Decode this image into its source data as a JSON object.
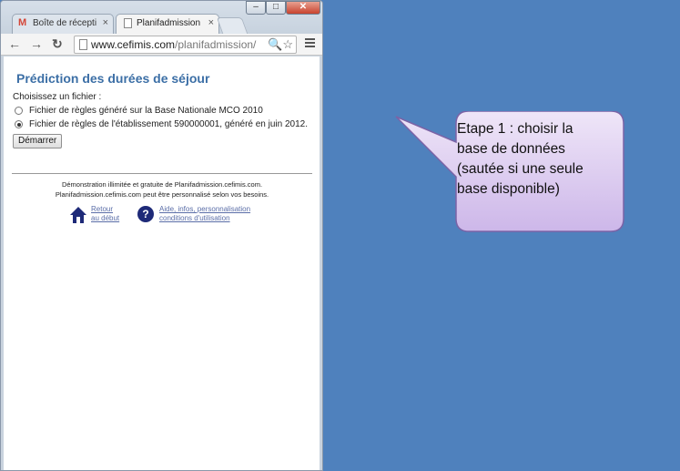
{
  "browser": {
    "tabs": [
      {
        "label": "Boîte de réceptio",
        "icon": "gmail-icon",
        "active": false
      },
      {
        "label": "Planifadmission.",
        "icon": "page-icon",
        "active": true
      }
    ],
    "address": {
      "host": "www.cefimis.com",
      "path": "/planifadmission/"
    }
  },
  "page": {
    "title": "Prédiction des durées de séjour",
    "choose_label": "Choisissez un fichier :",
    "options": [
      {
        "label": "Fichier de règles généré sur la Base Nationale MCO 2010",
        "checked": false
      },
      {
        "label": "Fichier de règles de l'établissement 590000001, généré en juin 2012.",
        "checked": true
      }
    ],
    "start_button": "Démarrer",
    "footer": {
      "line1": "Démonstration illimitée et gratuite de Planifadmission.cefimis.com.",
      "line2": "Planifadmission.cefimis.com peut être personnalisé selon vos besoins.",
      "home_link": {
        "line1": "Retour",
        "line2": "au début"
      },
      "help_link": {
        "line1": "Aide, infos, personnalisation",
        "line2": "conditions d'utilisation"
      }
    }
  },
  "callout": {
    "lines": [
      "Etape 1 : choisir la",
      "base de données",
      "(sautée si une seule",
      "base disponible)"
    ]
  },
  "colors": {
    "background": "#4f81bd",
    "title": "#3c6fa6",
    "callout_fill": "#d9c7ee",
    "callout_border": "#7b63a6"
  }
}
